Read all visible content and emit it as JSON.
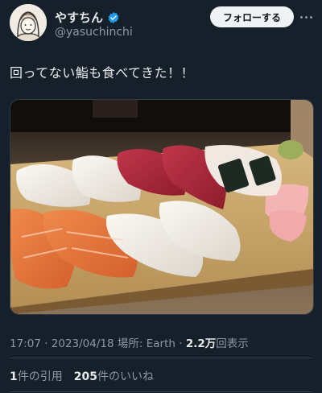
{
  "user": {
    "display_name": "やすちん",
    "handle": "@yasuchinchi",
    "verified_icon": "verified-badge-icon",
    "accent": "#1d9bf0"
  },
  "header": {
    "follow_label": "フォローする",
    "more_icon": "more-dots-icon"
  },
  "tweet": {
    "text": "回ってない鮨も食べてきた！！",
    "photo_icon": "sushi-platter-photo"
  },
  "meta": {
    "time": "17:07",
    "sep1": " · ",
    "date": "2023/04/18",
    "location_label": " 場所: ",
    "location": "Earth",
    "sep2": " · ",
    "views_count": "2.2万",
    "views_label": "回表示"
  },
  "stats": {
    "quotes_count": "1",
    "quotes_label": "件の引用",
    "likes_count": "205",
    "likes_label": "件のいいね"
  }
}
